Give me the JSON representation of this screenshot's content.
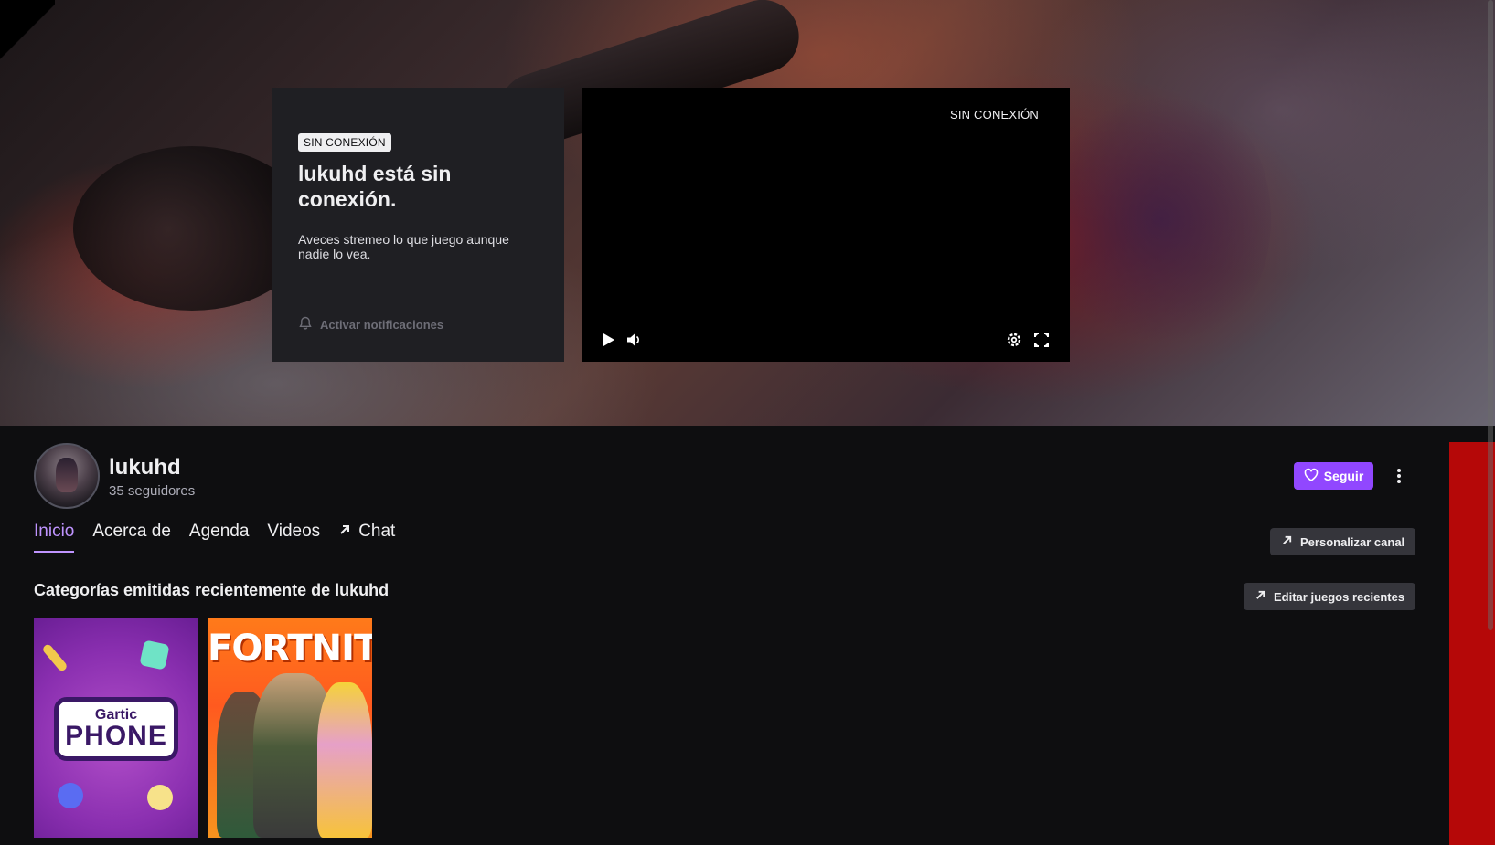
{
  "offline_card": {
    "badge": "SIN CONEXIÓN",
    "title": "lukuhd está sin conexión.",
    "description": "Aveces stremeo lo que juego aunque nadie lo vea.",
    "notify_label": "Activar notificaciones"
  },
  "player": {
    "status": "SIN CONEXIÓN",
    "controls": [
      "play-icon",
      "volume-icon",
      "settings-icon",
      "fullscreen-icon"
    ]
  },
  "channel": {
    "name": "lukuhd",
    "followers": "35 seguidores",
    "follow_label": "Seguir"
  },
  "tabs": [
    {
      "label": "Inicio",
      "active": true
    },
    {
      "label": "Acerca de"
    },
    {
      "label": "Agenda"
    },
    {
      "label": "Videos"
    },
    {
      "label": "Chat",
      "icon": "external-arrow-icon"
    }
  ],
  "actions": {
    "customize_label": "Personalizar canal",
    "edit_games_label": "Editar juegos recientes"
  },
  "recent": {
    "title": "Categorías emitidas recientemente de lukuhd",
    "games": [
      {
        "logo_top": "Gartic",
        "logo_bottom": "PHONE"
      },
      {
        "logo": "FORTNITE"
      }
    ]
  },
  "colors": {
    "accent": "#9147ff",
    "accent_text": "#bf94ff",
    "background": "#0e0e10",
    "card": "#1f1f23"
  }
}
